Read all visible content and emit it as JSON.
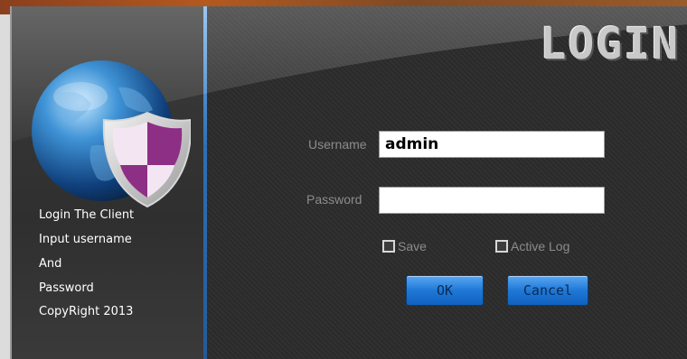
{
  "window": {
    "title": "LOGIN"
  },
  "info": {
    "lines": [
      "Login The Client",
      "Input username",
      "And",
      "Password",
      "CopyRight 2013"
    ]
  },
  "form": {
    "username_label": "Username",
    "username_value": "admin",
    "password_label": "Password",
    "password_value": "",
    "save_label": "Save",
    "save_checked": false,
    "active_log_label": "Active Log",
    "active_log_checked": false,
    "ok_label": "OK",
    "cancel_label": "Cancel"
  },
  "icons": {
    "globe": "globe-icon",
    "shield": "shield-icon"
  },
  "colors": {
    "background": "#2c2c2c",
    "accent_blue": "#1f78d6",
    "label_gray": "#8c8c8c",
    "shield_purple": "#8e2f86"
  }
}
